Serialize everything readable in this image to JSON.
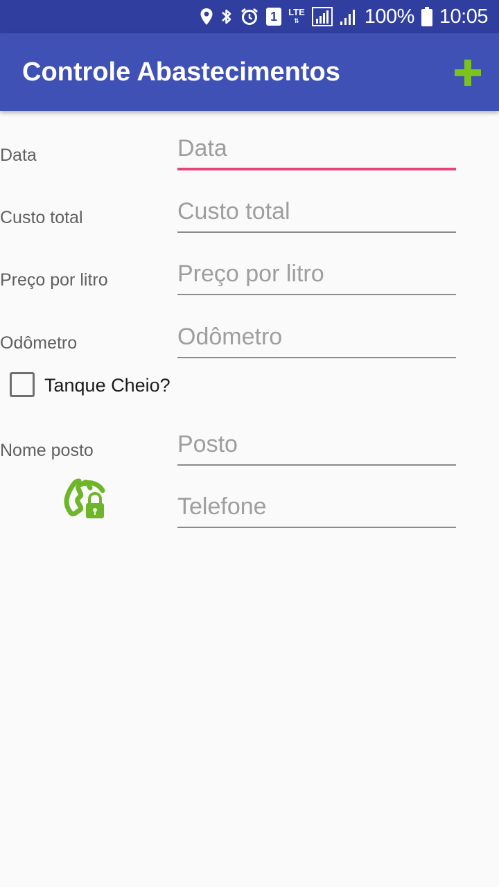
{
  "status_bar": {
    "icons": [
      "location-icon",
      "bluetooth-icon",
      "alarm-icon",
      "sim-1-icon",
      "lte-icon",
      "signal-icon",
      "signal-icon",
      "battery-icon"
    ],
    "network": "LTE",
    "sim_number": "1",
    "battery": "100%",
    "time": "10:05"
  },
  "app_bar": {
    "title": "Controle Abastecimentos",
    "add_icon": "plus-icon",
    "add_color": "#7cc21e"
  },
  "form": {
    "date": {
      "label": "Data",
      "placeholder": "Data",
      "value": ""
    },
    "total_cost": {
      "label": "Custo total",
      "placeholder": "Custo total",
      "value": ""
    },
    "price_per_liter": {
      "label": "Preço por litro",
      "placeholder": "Preço por litro",
      "value": ""
    },
    "odometer": {
      "label": "Odômetro",
      "placeholder": "Odômetro",
      "value": ""
    },
    "full_tank": {
      "label": "Tanque Cheio?",
      "checked": false
    },
    "station_name": {
      "label": "Nome posto",
      "placeholder": "Posto",
      "value": ""
    },
    "phone": {
      "icon": "phone-lock-icon",
      "placeholder": "Telefone",
      "value": ""
    }
  },
  "colors": {
    "status_bar": "#303f9f",
    "app_bar": "#3f51b5",
    "focus_accent": "#e5457b",
    "icon_green": "#7cc21e"
  }
}
